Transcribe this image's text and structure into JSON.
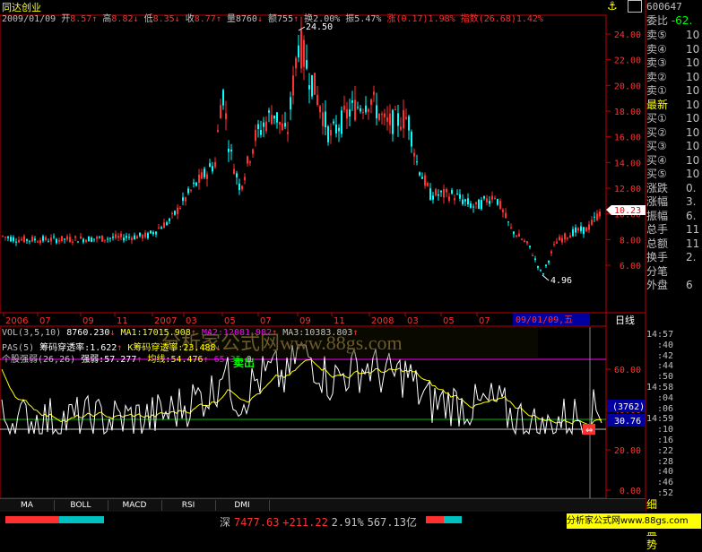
{
  "header": {
    "stock_name": "同达创业",
    "date": "2009/01/09",
    "open_label": "开",
    "open": "8.57",
    "high_label": "高",
    "high": "8.82",
    "low_label": "低",
    "low": "8.35",
    "close_label": "收",
    "close": "8.77",
    "volume_label": "量",
    "volume": "8760",
    "amount_label": "额",
    "amount": "755",
    "turnover_label": "换",
    "turnover": "2.00%",
    "amplitude_label": "振",
    "amplitude": "5.47%",
    "change_label": "涨",
    "change": "(0.17)1.98%",
    "index_label": "指数",
    "index": "(26.68)1.42%"
  },
  "price_axis": {
    "ticks": [
      "24.00",
      "22.00",
      "20.00",
      "18.00",
      "16.00",
      "14.00",
      "12.00",
      "10.00",
      "8.00",
      "6.00"
    ],
    "current": "10.23"
  },
  "annotations": {
    "high_mark": "24.50",
    "low_mark": "4.96"
  },
  "time_axis": {
    "labels": [
      "2006",
      "07",
      "09",
      "11",
      "2007",
      "03",
      "05",
      "07",
      "09",
      "11",
      "2008",
      "03",
      "05",
      "07",
      "09"
    ],
    "cursor_date": "09/01/09,五",
    "period": "日线"
  },
  "vol_line": {
    "prefix": "VOL(3,5,10)",
    "value": "8760.230",
    "ma1": "MA1:17015.908",
    "ma2": "MA2:12081.982",
    "ma3": "MA3:10383.803"
  },
  "pas_line": {
    "prefix": "PAS(5)",
    "r1_label": "筹码穿透率:",
    "r1": "1.622",
    "r2_label": "K筹码穿透率:",
    "r2": "23.488"
  },
  "strength_line": {
    "prefix": "个股强弱(26,26)",
    "strong_label": "强弱:",
    "strong": "57.277",
    "avg_label": "均线:",
    "avg": "54.476",
    "v65": "65",
    "v35": "35",
    "v0": "0"
  },
  "sell_signal": "卖出",
  "watermark": "分析家公式网www.88gs.com",
  "sub_axis": {
    "ticks": [
      "60.00",
      "40.00",
      "20.00",
      "0.00"
    ],
    "box1": "(3762)",
    "box2": "30.76"
  },
  "quote_panel": {
    "code": "600647",
    "ratio_label": "委比",
    "ratio": "-62.",
    "rows": [
      {
        "label": "卖⑤",
        "val": "10"
      },
      {
        "label": "卖④",
        "val": "10"
      },
      {
        "label": "卖③",
        "val": "10"
      },
      {
        "label": "卖②",
        "val": "10"
      },
      {
        "label": "卖①",
        "val": "10"
      },
      {
        "label": "最新",
        "val": "10"
      },
      {
        "label": "买①",
        "val": "10"
      },
      {
        "label": "买②",
        "val": "10"
      },
      {
        "label": "买③",
        "val": "10"
      },
      {
        "label": "买④",
        "val": "10"
      },
      {
        "label": "买⑤",
        "val": "10"
      },
      {
        "label": "涨跌",
        "val": "0."
      },
      {
        "label": "涨幅",
        "val": "3."
      },
      {
        "label": "振幅",
        "val": "6."
      },
      {
        "label": "总手",
        "val": "11"
      },
      {
        "label": "总额",
        "val": "11"
      },
      {
        "label": "换手",
        "val": "2."
      },
      {
        "label": "分笔",
        "val": ""
      },
      {
        "label": "外盘",
        "val": "6"
      }
    ],
    "times": [
      {
        "t": "14:57",
        "v": ""
      },
      {
        "t": ":40",
        "v": ""
      },
      {
        "t": ":42",
        "v": ""
      },
      {
        "t": ":44",
        "v": ""
      },
      {
        "t": ":50",
        "v": ""
      },
      {
        "t": "14:58",
        "v": ""
      },
      {
        "t": ":04",
        "v": ""
      },
      {
        "t": ":06",
        "v": ""
      },
      {
        "t": "14:59",
        "v": ""
      },
      {
        "t": ":10",
        "v": ""
      },
      {
        "t": ":16",
        "v": ""
      },
      {
        "t": ":22",
        "v": ""
      },
      {
        "t": ":28",
        "v": ""
      },
      {
        "t": ":40",
        "v": ""
      },
      {
        "t": ":46",
        "v": ""
      },
      {
        "t": ":52",
        "v": ""
      }
    ],
    "footer_tabs": "细价盘势"
  },
  "tabs": [
    "MA",
    "BOLL",
    "MACD",
    "RSI",
    "DMI"
  ],
  "status": {
    "market": "深",
    "index": "7477.63",
    "change": "+211.22",
    "pct": "2.91%",
    "amount": "567.13亿",
    "site": "分析家公式网www.88gs.com"
  },
  "colors": {
    "up": "#ff3030",
    "down": "#00ffff",
    "frame": "#c00000",
    "yellow": "#ffff00"
  }
}
